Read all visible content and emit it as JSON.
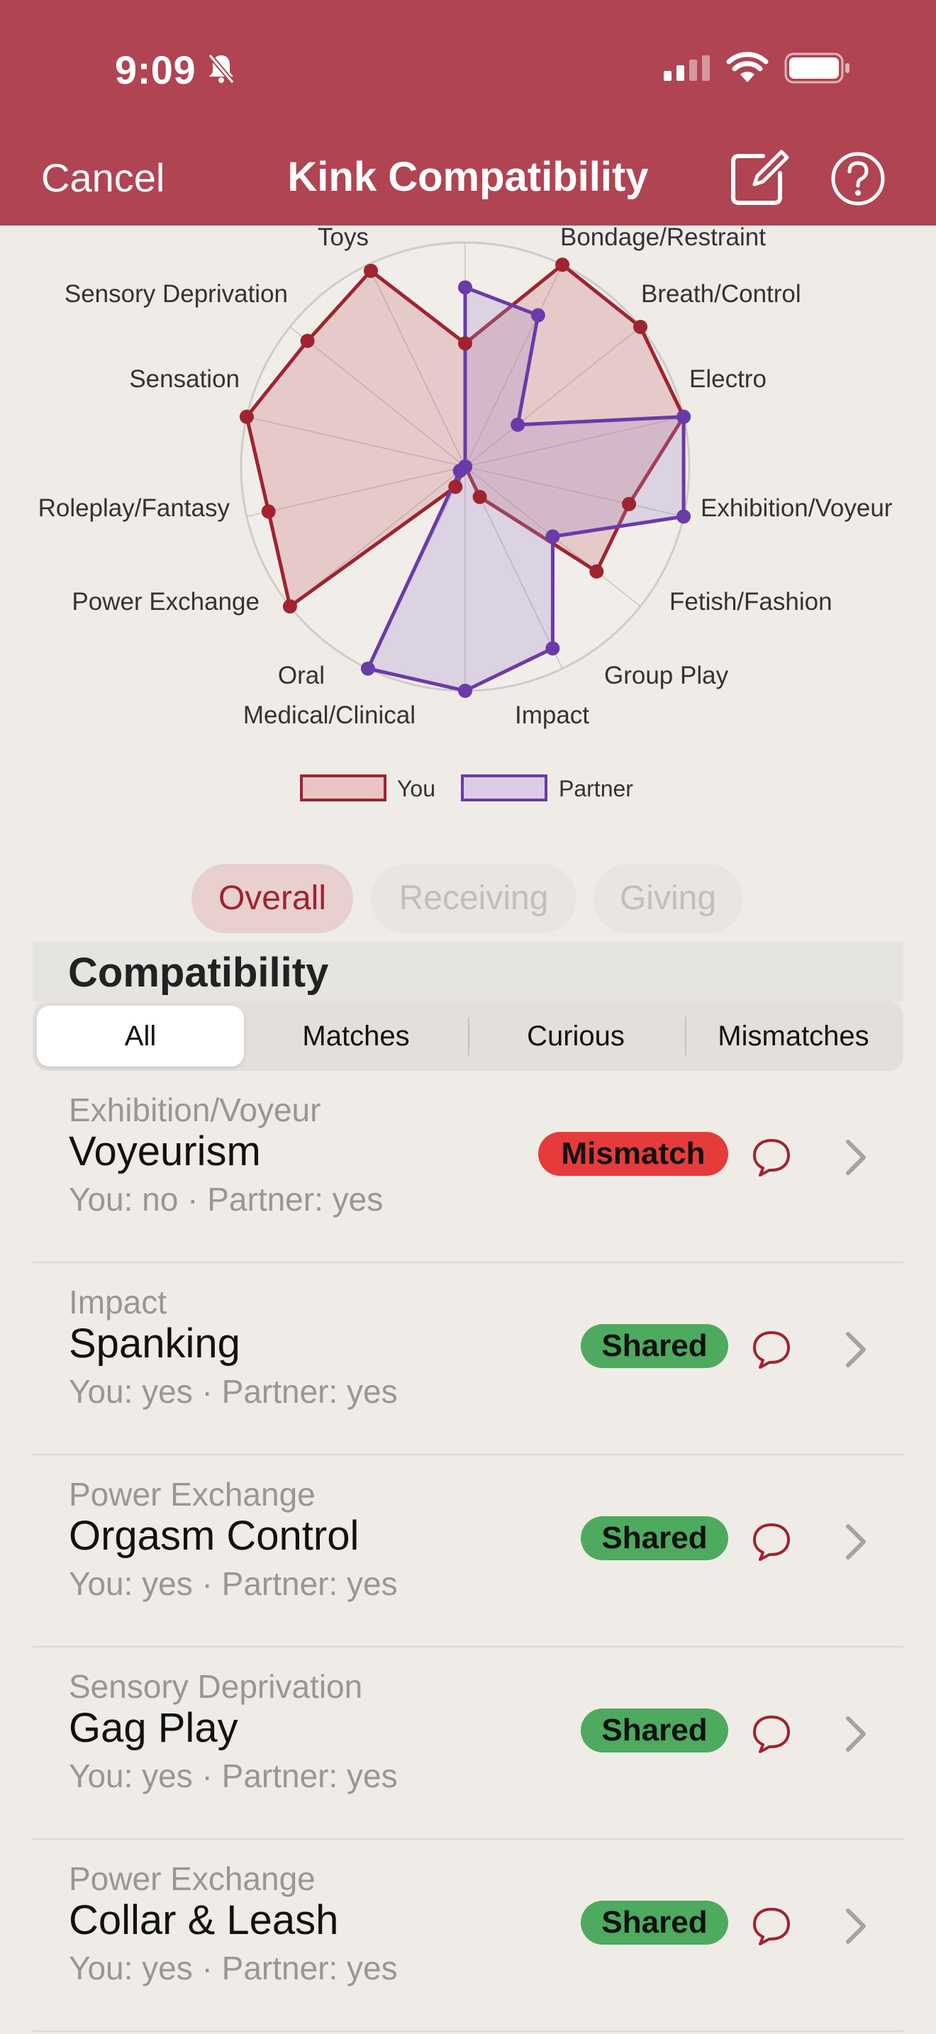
{
  "status_bar": {
    "time": "9:09"
  },
  "nav": {
    "cancel_label": "Cancel",
    "title": "Kink Compatibility"
  },
  "chart_data": {
    "type": "radar",
    "axes": [
      "Toys",
      "Bondage/Restraint",
      "Breath/Control",
      "Electro",
      "Exhibition/Voyeur",
      "Fetish/Fashion",
      "Group Play",
      "Impact",
      "Medical/Clinical",
      "Oral",
      "Power Exchange",
      "Roleplay/Fantasy",
      "Sensation",
      "Sensory Deprivation"
    ],
    "rmax": 1,
    "series": [
      {
        "name": "You",
        "color": "#a0232f",
        "fill": "rgba(200,110,120,0.28)",
        "values": [
          0.55,
          1.0,
          1.0,
          1.0,
          0.75,
          0.75,
          0.15,
          0.0,
          0.1,
          1.0,
          0.9,
          1.0,
          0.9,
          0.97
        ]
      },
      {
        "name": "Partner",
        "color": "#6a3ba8",
        "fill": "rgba(160,140,205,0.28)",
        "values": [
          0.8,
          0.75,
          0.3,
          1.0,
          1.0,
          0.5,
          0.9,
          1.0,
          1.0,
          0.03,
          0.0,
          0.0,
          0.0,
          0.0
        ]
      }
    ],
    "grid": true,
    "legend": "bottom-center"
  },
  "segments": {
    "overall": "Overall",
    "receiving": "Receiving",
    "giving": "Giving"
  },
  "section": {
    "title": "Compatibility"
  },
  "filters": {
    "all": "All",
    "matches": "Matches",
    "curious": "Curious",
    "mismatches": "Mismatches"
  },
  "items": [
    {
      "category": "Exhibition/Voyeur",
      "title": "Voyeurism",
      "sub": "You: no · Partner: yes",
      "badge": "Mismatch"
    },
    {
      "category": "Impact",
      "title": "Spanking",
      "sub": "You: yes · Partner: yes",
      "badge": "Shared"
    },
    {
      "category": "Power Exchange",
      "title": "Orgasm Control",
      "sub": "You: yes · Partner: yes",
      "badge": "Shared"
    },
    {
      "category": "Sensory Deprivation",
      "title": "Gag Play",
      "sub": "You: yes · Partner: yes",
      "badge": "Shared"
    },
    {
      "category": "Power Exchange",
      "title": "Collar & Leash",
      "sub": "You: yes · Partner: yes",
      "badge": "Shared"
    }
  ]
}
